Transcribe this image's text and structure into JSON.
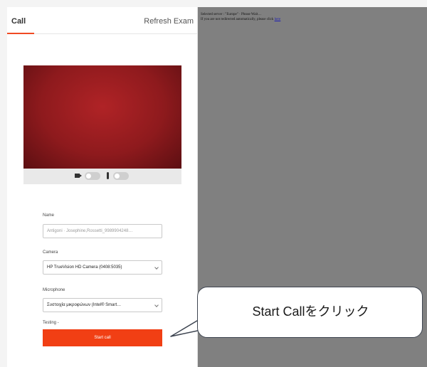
{
  "tabs": {
    "call": "Call",
    "refresh": "Refresh Exam"
  },
  "form": {
    "name_label": "Name",
    "name_value": "Antigoni · Josephine,Rossetti_9989904248…",
    "camera_label": "Camera",
    "camera_value": "HP TrueVision HD Camera (0408:5035)",
    "microphone_label": "Microphone",
    "microphone_value": "Συστοιχία μικροφώνων (Intel® Smart…",
    "testing_label": "Testing -",
    "start_button": "Start call"
  },
  "right_panel": {
    "line1": "Selected server : \"Europe\" · Please Wait…",
    "line2_prefix": "If you are not redirected automatically, please click",
    "line2_link": "here"
  },
  "callout": {
    "text": "Start Callをクリック"
  },
  "colors": {
    "accent": "#f13f14",
    "right_panel_bg": "#808080",
    "video_bg": "#8e1a1d"
  }
}
